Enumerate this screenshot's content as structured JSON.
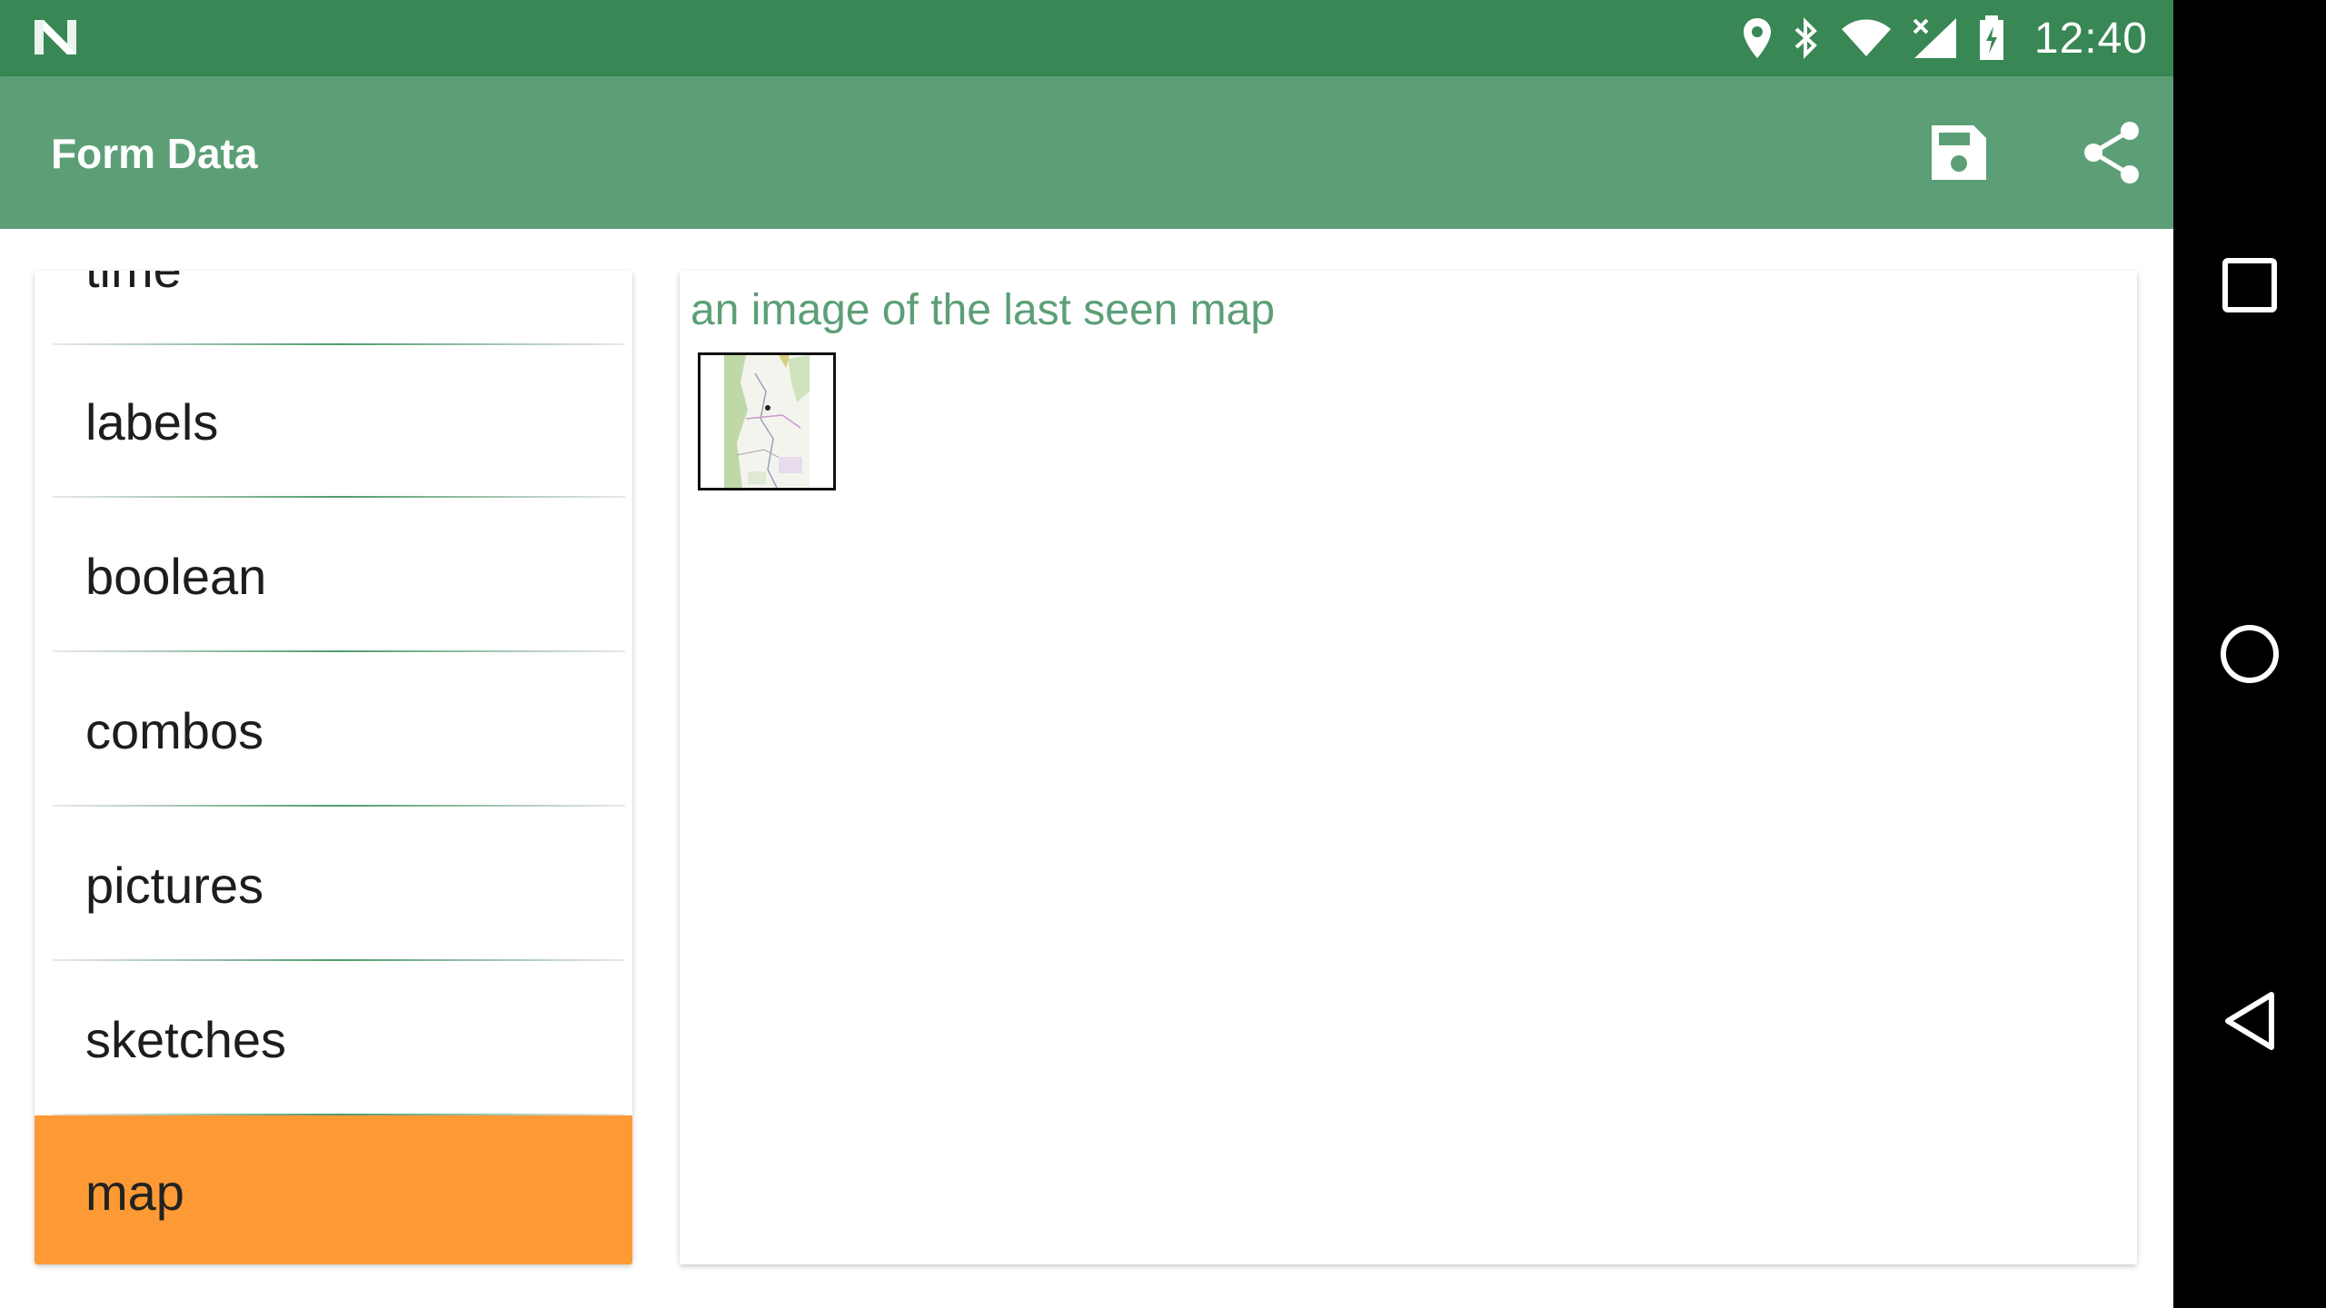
{
  "status_bar": {
    "time": "12:40",
    "icons": [
      "n-logo-icon",
      "location-icon",
      "bluetooth-icon",
      "wifi-icon",
      "cell-signal-icon",
      "battery-charging-icon"
    ]
  },
  "app_bar": {
    "title": "Form Data",
    "actions": [
      "save-icon",
      "share-icon"
    ]
  },
  "sections": [
    {
      "label": "time"
    },
    {
      "label": "labels"
    },
    {
      "label": "boolean"
    },
    {
      "label": "combos"
    },
    {
      "label": "pictures"
    },
    {
      "label": "sketches"
    },
    {
      "label": "map",
      "selected": true
    }
  ],
  "detail": {
    "label": "an image of the last seen map"
  },
  "colors": {
    "status_bar": "#388754",
    "app_bar": "#5c9f77",
    "accent_text": "#5c9f77",
    "selected_item": "#fe9a35"
  },
  "nav_bar": {
    "buttons": [
      "recents-icon",
      "home-icon",
      "back-icon"
    ]
  }
}
